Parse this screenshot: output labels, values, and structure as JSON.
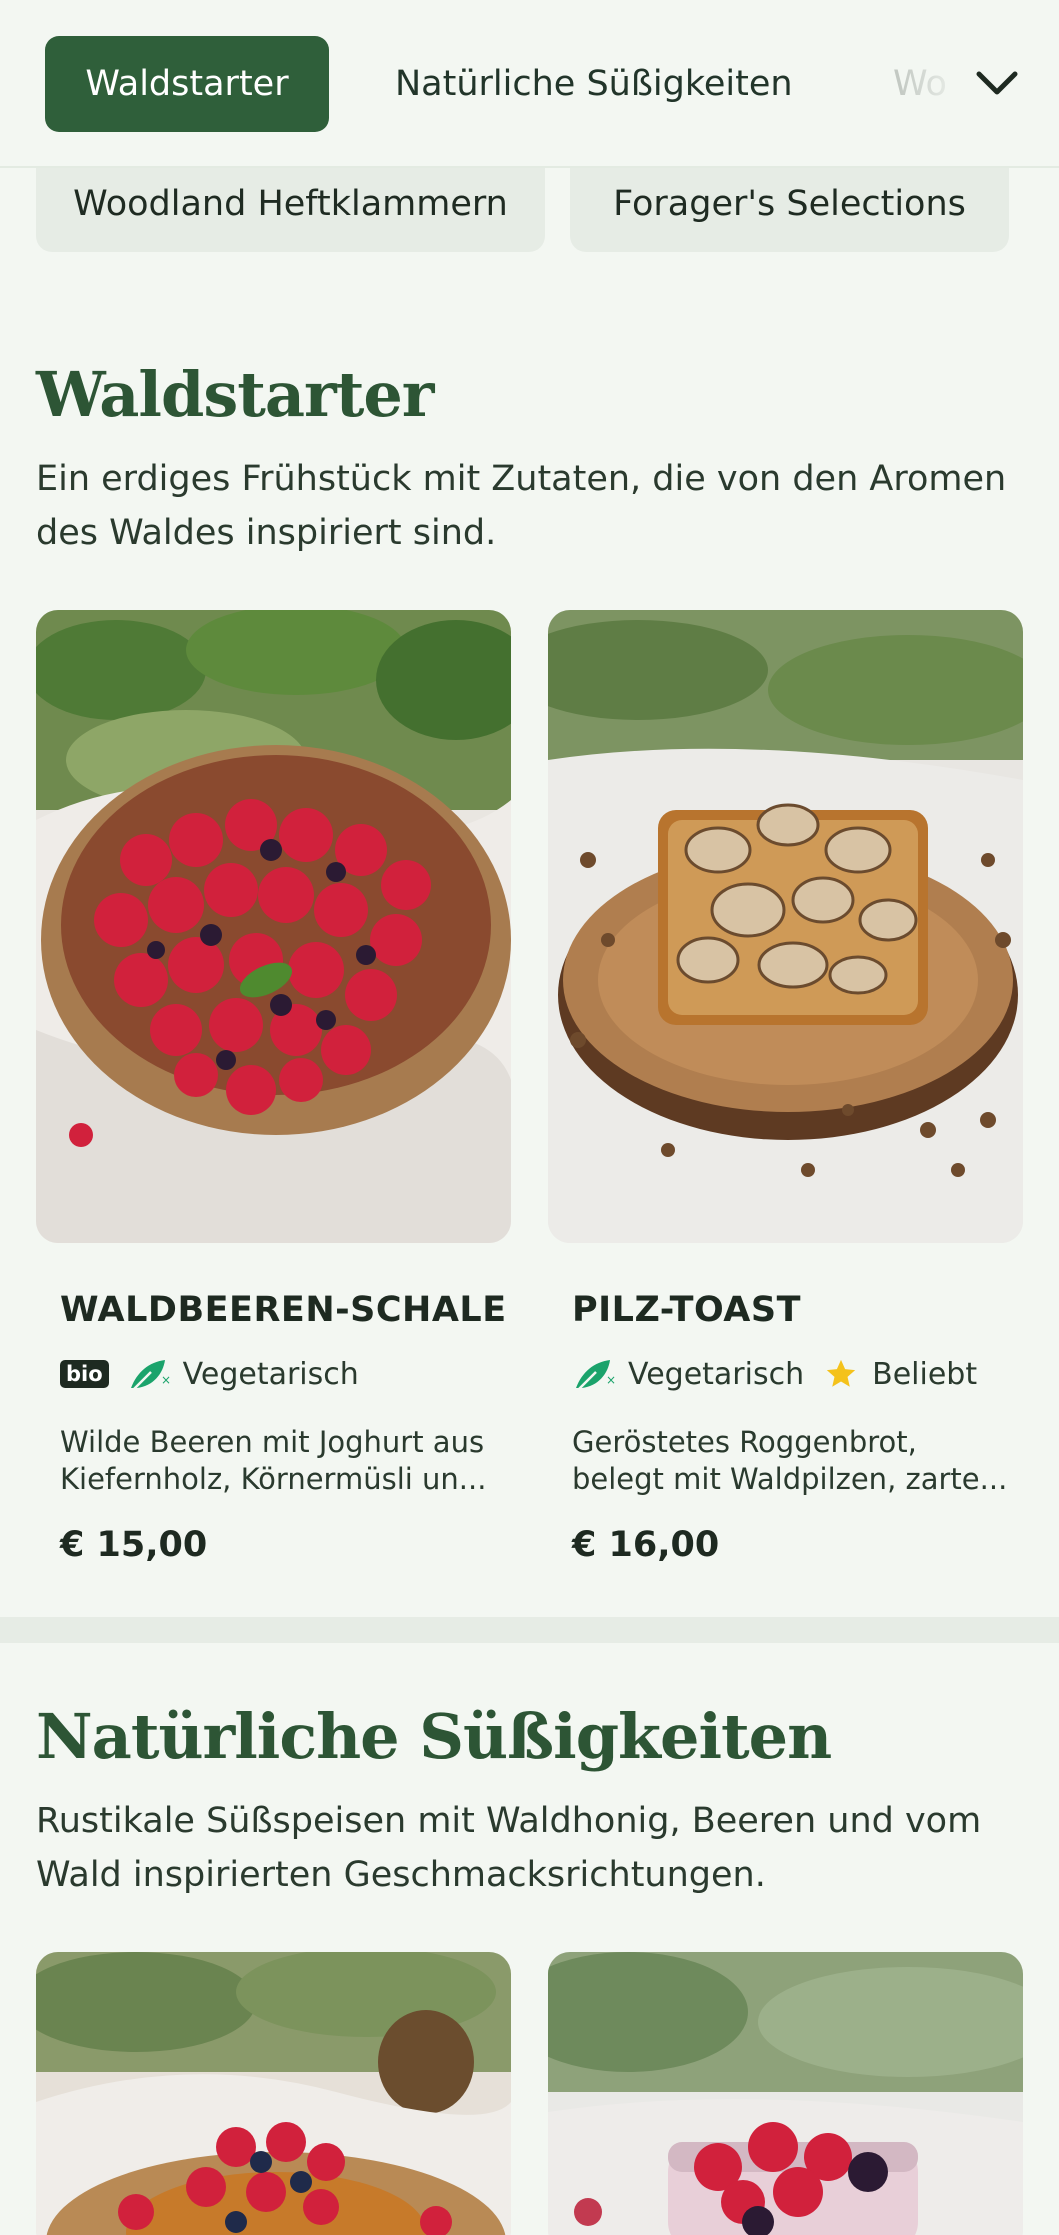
{
  "nav": {
    "tabs": [
      "Waldstarter",
      "Natürliche Süßigkeiten",
      "Wo"
    ],
    "subcategories": [
      "Woodland Heftklammern",
      "Forager's Selections"
    ]
  },
  "sections": [
    {
      "title": "Waldstarter",
      "description": "Ein erdiges Frühstück mit Zutaten, die von den Aromen des Waldes inspiriert sind.",
      "items": [
        {
          "name": "WALDBEEREN-SCHALE",
          "bio": "bio",
          "vegetarian": "Vegetarisch",
          "desc_line1": "Wilde Beeren mit Joghurt aus",
          "desc_line2": "Kiefernholz, Körnermüsli un...",
          "price": "€ 15,00"
        },
        {
          "name": "PILZ-TOAST",
          "vegetarian": "Vegetarisch",
          "popular": "Beliebt",
          "desc_line1": "Geröstetes Roggenbrot,",
          "desc_line2": "belegt mit Waldpilzen, zarte...",
          "price": "€ 16,00"
        }
      ]
    },
    {
      "title": "Natürliche Süßigkeiten",
      "description": "Rustikale Süßspeisen mit Waldhonig, Beeren und vom Wald inspirierten Geschmacksrichtungen."
    }
  ],
  "colors": {
    "accent": "#2f5f3a",
    "heading": "#2d5535",
    "vegetarian_icon": "#1aa36b",
    "star": "#f4c21b",
    "background": "#f3f7f2"
  },
  "icons": [
    "chevron-down-icon",
    "vegetarian-leaf-icon",
    "star-icon"
  ]
}
